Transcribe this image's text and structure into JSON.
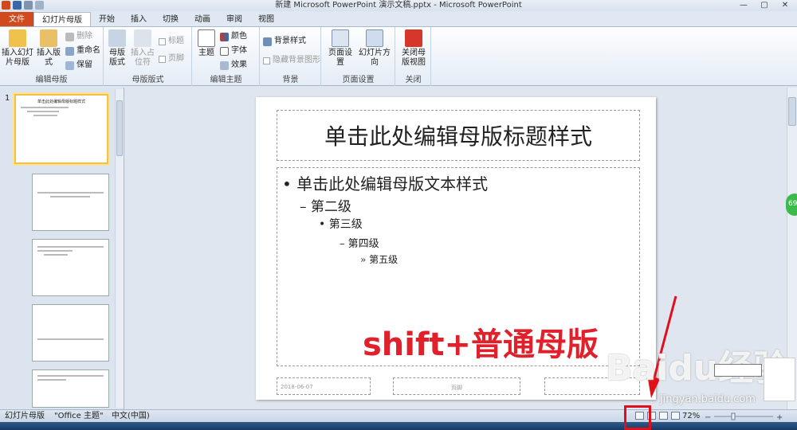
{
  "window": {
    "title": "新建 Microsoft PowerPoint 演示文稿.pptx - Microsoft PowerPoint"
  },
  "tabs": [
    "文件",
    "幻灯片母版",
    "开始",
    "插入",
    "切换",
    "动画",
    "审阅",
    "视图"
  ],
  "ribbon": {
    "edit_master": {
      "label": "编辑母版",
      "insert_slide_master": "插入幻灯片母版",
      "insert_layout": "插入版式",
      "delete": "删除",
      "rename": "重命名",
      "preserve": "保留"
    },
    "master_layout": {
      "label": "母版版式",
      "master_layout_btn": "母版版式",
      "insert_placeholder": "插入占位符",
      "title_check": "标题",
      "footer_check": "页脚"
    },
    "edit_theme": {
      "label": "编辑主题",
      "themes": "主题",
      "colors": "颜色",
      "fonts": "字体",
      "effects": "效果"
    },
    "background": {
      "label": "背景",
      "background_styles": "背景样式",
      "hide_background": "隐藏背景图形"
    },
    "page_setup": {
      "label": "页面设置",
      "page_setup_btn": "页面设置",
      "orientation": "幻灯片方向"
    },
    "close": {
      "label": "关闭",
      "close_master": "关闭母版视图"
    }
  },
  "thumbnails": {
    "master_number": "1",
    "master_title": "单击此处编辑母版标题样式"
  },
  "slide": {
    "title": "单击此处编辑母版标题样式",
    "levels": [
      "单击此处编辑母版文本样式",
      "第二级",
      "第三级",
      "第四级",
      "第五级"
    ],
    "bullets": [
      "•",
      "–",
      "•",
      "–",
      "»"
    ],
    "date": "2018-06-07",
    "footer": "页脚"
  },
  "annotation": {
    "overlay_text": "shift+普通母版",
    "watermark": "Baidu经验",
    "watermark_url": "jingyan.baidu.com",
    "side_badge": "69"
  },
  "statusbar": {
    "view": "幻灯片母版",
    "theme": "\"Office 主题\"",
    "language": "中文(中国)",
    "zoom": "72%"
  },
  "colors": {
    "file_tab": "#d04a1d",
    "annotation_red": "#e0202a",
    "thumbnail_selected": "#f1c14a"
  }
}
